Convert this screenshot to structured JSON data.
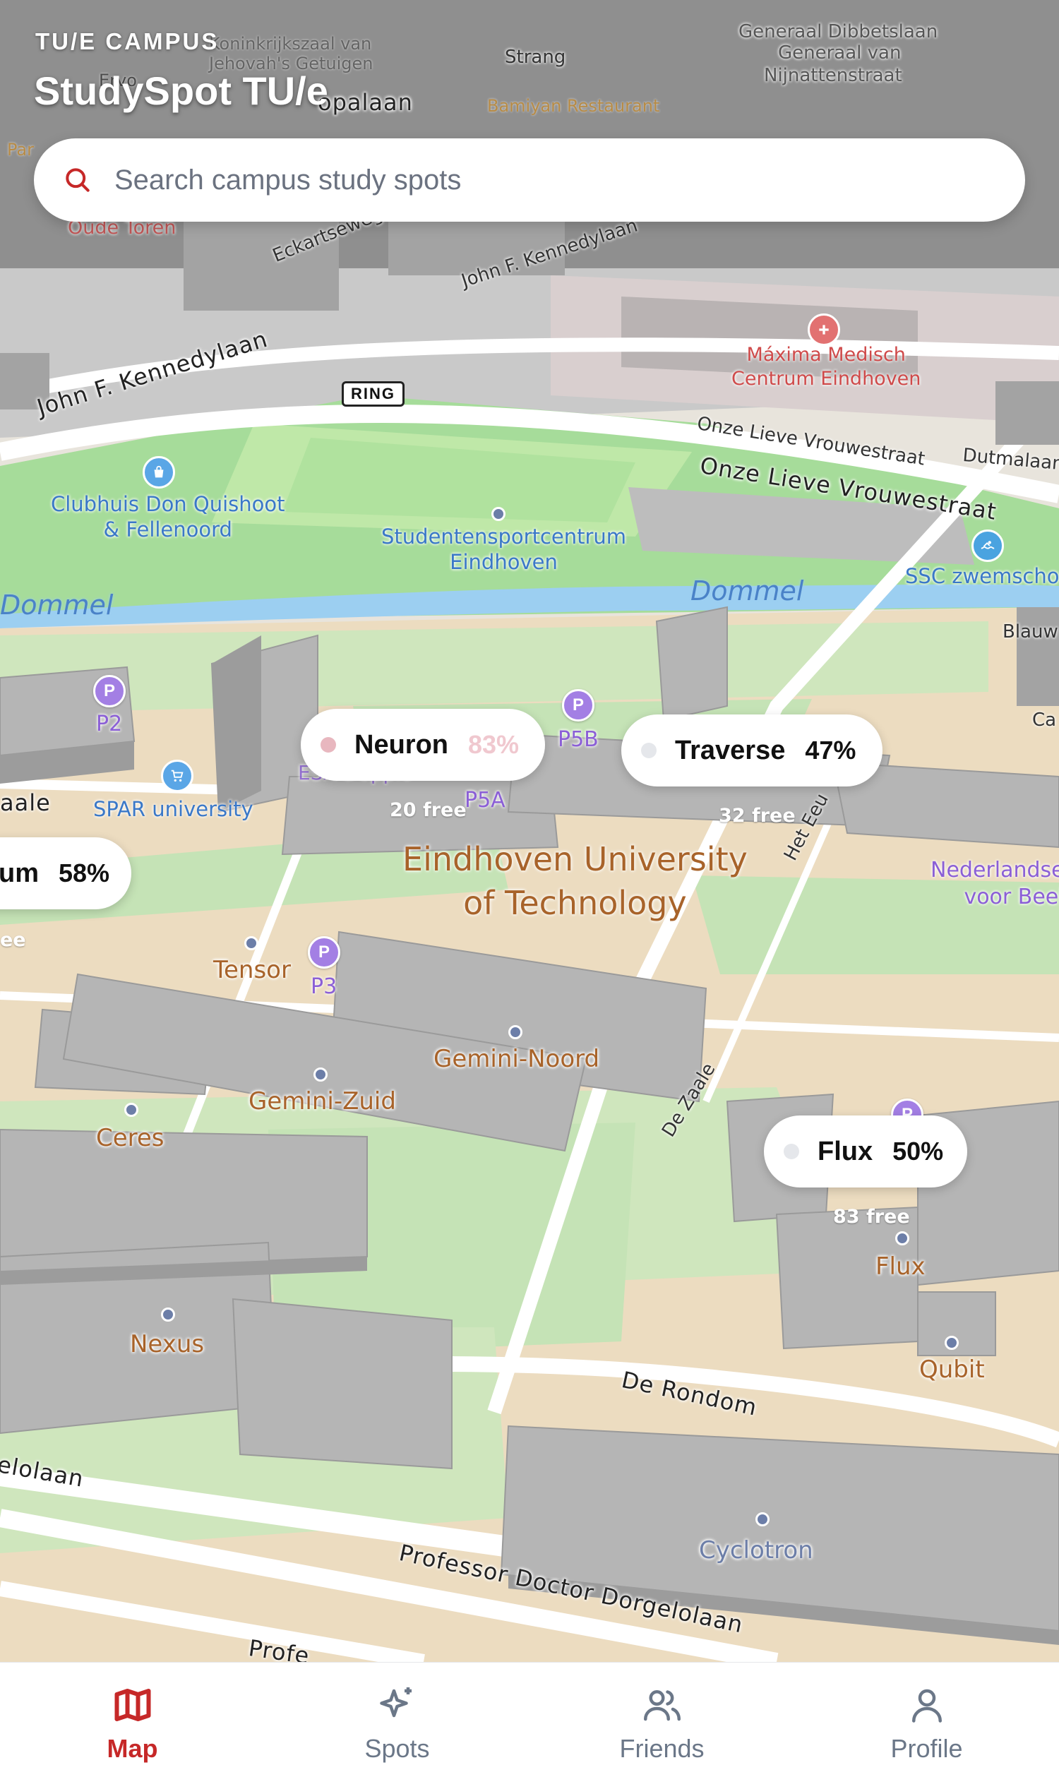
{
  "header": {
    "subtitle": "TU/E CAMPUS",
    "title": "StudySpot TU/e"
  },
  "search": {
    "placeholder": "Search campus study spots"
  },
  "map": {
    "roads": [
      "John F. Kennedylaan",
      "John F. Kennedylaan",
      "Eckartseweg Z",
      "Onze Lieve Vrouwestraat",
      "Onze Lieve Vrouwestraat",
      "Dutmalaan",
      "Het Eeu",
      "De Zaale",
      "De Rondom",
      "Professor Doctor Dorgelolaan",
      "elolaan",
      "Profe",
      "Strang",
      "opalaan",
      "Generaal Dibbetslaan",
      "Generaal van",
      "Nijnattenstraat",
      "aale",
      "Blauw",
      "Ca"
    ],
    "ring_sign": "RING",
    "water": [
      "Dommel",
      "Dommel"
    ],
    "pois": {
      "clubhuis": "Clubhuis Don Quishoot\n& Fellenoord",
      "sportcentrum": "Studentensportcentrum\nEindhoven",
      "maxima": "Máxima Medisch\nCentrum Eindhoven",
      "ssc": "SSC zwemschoo",
      "spar": "SPAR university",
      "nederlandse": "Nederlandse\nvoor Beel",
      "oude_toren": "Oude Toren",
      "bamiyan": "Bamiyan Restaurant",
      "koninkrijk": "Koninkrijkszaal van\nJehovah's Getuigen",
      "tue": "Eindhoven University\nof Technology",
      "esa": "ESA Doppio",
      "par": "Par",
      "ervo": "Ervo"
    },
    "buildings": {
      "tensor": "Tensor",
      "gemini_noord": "Gemini-Noord",
      "gemini_zuid": "Gemini-Zuid",
      "ceres": "Ceres",
      "nexus": "Nexus",
      "flux": "Flux",
      "qubit": "Qubit",
      "cyclotron": "Cyclotron"
    },
    "parking": {
      "p2": "P2",
      "p3": "P3",
      "p5a": "P5A",
      "p5b": "P5B",
      "p_letter": "P"
    },
    "free": {
      "neuron": "20 free",
      "traverse": "32 free",
      "flux": "83 free",
      "atrium": "ee"
    }
  },
  "spots": {
    "neuron": {
      "name": "Neuron",
      "pct": "83%",
      "occupancy": 0.83,
      "dot_color": "#e8b7bf",
      "pct_color": "#f0c8cf"
    },
    "traverse": {
      "name": "Traverse",
      "pct": "47%",
      "occupancy": 0.47,
      "dot_color": "#e5e7eb",
      "pct_color": "#111111"
    },
    "atrium": {
      "name": "um",
      "pct": "58%",
      "occupancy": 0.58,
      "dot_color": "#e5e7eb",
      "pct_color": "#111111"
    },
    "flux": {
      "name": "Flux",
      "pct": "50%",
      "occupancy": 0.5,
      "dot_color": "#e5e7eb",
      "pct_color": "#111111"
    }
  },
  "tabs": [
    {
      "label": "Map",
      "icon": "map-icon",
      "active": true
    },
    {
      "label": "Spots",
      "icon": "sparkles-icon",
      "active": false
    },
    {
      "label": "Friends",
      "icon": "users-icon",
      "active": false
    },
    {
      "label": "Profile",
      "icon": "user-icon",
      "active": false
    }
  ],
  "colors": {
    "accent": "#c62828",
    "tab_inactive": "#6b7788",
    "parking": "#a37fe4",
    "water": "#9ccff1",
    "grass": "#a6dc9a"
  }
}
